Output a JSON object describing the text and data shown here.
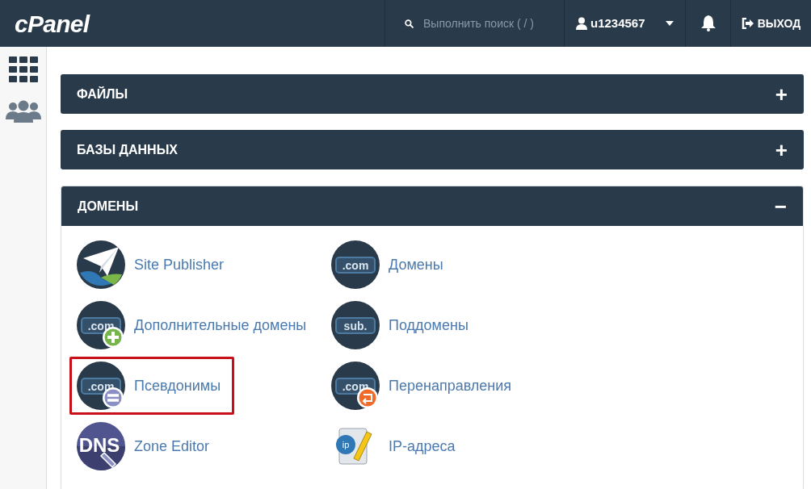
{
  "header": {
    "logo": "cPanel",
    "search": {
      "placeholder": "Выполнить поиск ( / )"
    },
    "user": "u1234567",
    "logout": "ВЫХОД"
  },
  "sections": [
    {
      "title": "ФАЙЛЫ",
      "expanded": false,
      "toggle": "+"
    },
    {
      "title": "БАЗЫ ДАННЫХ",
      "expanded": false,
      "toggle": "+"
    },
    {
      "title": "ДОМЕНЫ",
      "expanded": true,
      "toggle": "−",
      "items": [
        {
          "label": "Site Publisher",
          "kind": "publisher",
          "highlighted": false
        },
        {
          "label": "Домены",
          "kind": "domain",
          "icon_text": ".com",
          "highlighted": false
        },
        {
          "label": "Дополнительные домены",
          "kind": "addon",
          "icon_text": ".com",
          "highlighted": false
        },
        {
          "label": "Поддомены",
          "kind": "domain",
          "icon_text": "sub.",
          "highlighted": false
        },
        {
          "label": "Псевдонимы",
          "kind": "alias",
          "icon_text": ".com",
          "highlighted": true
        },
        {
          "label": "Перенаправления",
          "kind": "redirect",
          "icon_text": ".com",
          "highlighted": false
        },
        {
          "label": "Zone Editor",
          "kind": "dns",
          "icon_text": "DNS",
          "highlighted": false
        },
        {
          "label": "IP-адреса",
          "kind": "ip",
          "icon_text": "ip",
          "highlighted": false
        }
      ]
    }
  ]
}
